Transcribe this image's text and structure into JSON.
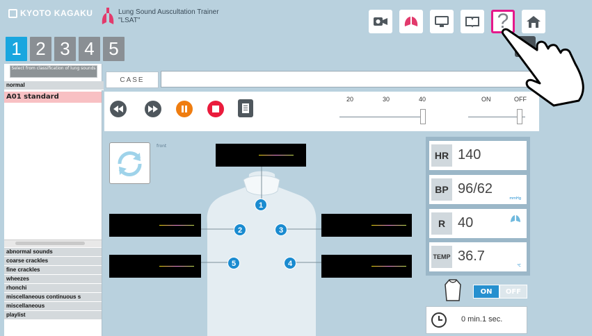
{
  "header": {
    "logo": "KYOTO KAGAKU",
    "title_line1": "Lung Sound Auscultation Trainer",
    "title_line2": "\"LSAT\""
  },
  "tabs": [
    "1",
    "2",
    "3",
    "4",
    "5"
  ],
  "toolbar": {
    "help_label": "?",
    "icons": [
      "camera-icon",
      "lungs-icon",
      "monitor-icon",
      "book-icon",
      "help-icon",
      "home-icon"
    ]
  },
  "left_panel": {
    "select_label": "Select from classification of lung sounds",
    "normal_category": "normal",
    "selected_item": "A01 standard",
    "categories": [
      "abnormal sounds",
      "coarse crackles",
      "fine crackles",
      "wheezes",
      "rhonchi",
      "miscellaneous continuous s",
      "miscellaneous",
      "playlist"
    ]
  },
  "case": {
    "label": "CASE",
    "value": ""
  },
  "volume": {
    "scale": [
      "20",
      "30",
      "40"
    ]
  },
  "toggle_scale": {
    "on": "ON",
    "off": "OFF"
  },
  "body": {
    "view_label": "front",
    "points": [
      "1",
      "2",
      "3",
      "4",
      "5"
    ]
  },
  "vitals": {
    "hr_label": "HR",
    "hr_value": "140",
    "bp_label": "BP",
    "bp_value": "96/62",
    "bp_unit": "mmHg",
    "r_label": "R",
    "r_value": "40",
    "temp_label": "TEMP",
    "temp_value": "36.7",
    "temp_unit": "℃"
  },
  "switch": {
    "on": "ON",
    "off": "OFF",
    "state": "ON"
  },
  "timer": {
    "text": "0 min.1 sec."
  },
  "colors": {
    "accent": "#19a6df",
    "highlight": "#e5188a",
    "selected_row": "#f8c0c3"
  }
}
